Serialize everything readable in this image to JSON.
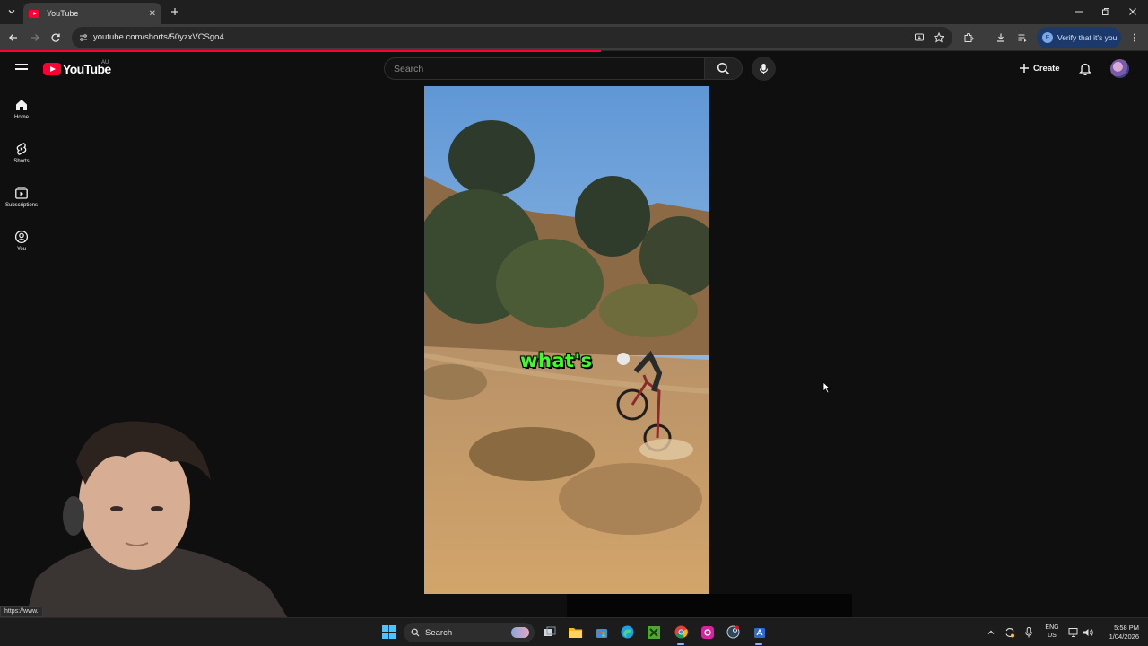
{
  "browser": {
    "tab_title": "YouTube",
    "url": "youtube.com/shorts/50yzxVCSgo4",
    "verify_label": "Verify that it's you",
    "profile_initial": "E",
    "status_url": "https://www."
  },
  "youtube": {
    "logo_text": "YouTube",
    "region": "AU",
    "search_placeholder": "Search",
    "create_label": "Create",
    "sidebar": {
      "items": [
        {
          "label": "Home",
          "icon": "home-icon"
        },
        {
          "label": "Shorts",
          "icon": "shorts-icon"
        },
        {
          "label": "Subscriptions",
          "icon": "subscriptions-icon"
        },
        {
          "label": "You",
          "icon": "you-icon"
        }
      ]
    },
    "short": {
      "caption": "what's"
    }
  },
  "taskbar": {
    "search_label": "Search",
    "lang_top": "ENG",
    "lang_bottom": "US",
    "time": "5:58 PM",
    "date": "1/04/2026"
  },
  "colors": {
    "brand_red": "#ff0033",
    "caption_green": "#3bff22",
    "background": "#0f0f0f"
  }
}
